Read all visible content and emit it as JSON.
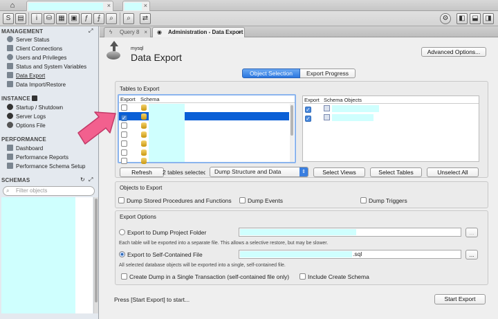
{
  "connection_tabs": [
    {
      "label": "",
      "close": "×"
    },
    {
      "label": "",
      "close": "×"
    }
  ],
  "sidebar": {
    "management_title": "MANAGEMENT",
    "management_items": [
      {
        "label": "Server Status",
        "icon": "server-status-icon"
      },
      {
        "label": "Client Connections",
        "icon": "client-connections-icon"
      },
      {
        "label": "Users and Privileges",
        "icon": "users-icon"
      },
      {
        "label": "Status and System Variables",
        "icon": "variables-icon"
      },
      {
        "label": "Data Export",
        "icon": "data-export-icon"
      },
      {
        "label": "Data Import/Restore",
        "icon": "data-import-icon"
      }
    ],
    "instance_title": "INSTANCE",
    "instance_items": [
      {
        "label": "Startup / Shutdown"
      },
      {
        "label": "Server Logs"
      },
      {
        "label": "Options File"
      }
    ],
    "performance_title": "PERFORMANCE",
    "performance_items": [
      {
        "label": "Dashboard"
      },
      {
        "label": "Performance Reports"
      },
      {
        "label": "Performance Schema Setup"
      }
    ],
    "schemas_title": "SCHEMAS",
    "filter_placeholder": "Filter objects"
  },
  "doc_tabs": [
    {
      "label": "Query 8",
      "close": "×"
    },
    {
      "label": "Administration - Data Export",
      "close": "×"
    }
  ],
  "header": {
    "subtitle": "mysql",
    "title": "Data Export",
    "advanced_button": "Advanced Options..."
  },
  "view_tabs": {
    "selected": "Object Selection",
    "other": "Export Progress"
  },
  "tables_to_export": {
    "title": "Tables to Export",
    "col_export": "Export",
    "col_schema": "Schema",
    "col_export2": "Export",
    "col_schema_objects": "Schema Objects",
    "refresh_button": "Refresh",
    "selected_count": "2 tables selected",
    "dump_mode": "Dump Structure and Data",
    "select_views_button": "Select Views",
    "select_tables_button": "Select Tables",
    "unselect_all_button": "Unselect All"
  },
  "objects_to_export": {
    "title": "Objects to Export",
    "dump_routines": "Dump Stored Procedures and Functions",
    "dump_events": "Dump Events",
    "dump_triggers": "Dump Triggers"
  },
  "export_options": {
    "title": "Export Options",
    "to_folder": "Export to Dump Project Folder",
    "folder_note": "Each table will be exported into a separate file. This allows a selective restore, but may be slower.",
    "to_file": "Export to Self-Contained File",
    "file_suffix": ".sql",
    "file_note": "All selected database objects will be exported into a single, self-contained file.",
    "single_transaction": "Create Dump in a Single Transaction (self-contained file only)",
    "include_schema": "Include Create Schema",
    "browse": "..."
  },
  "footer": {
    "hint": "Press [Start Export] to start...",
    "start_button": "Start Export"
  },
  "colors": {
    "accent": "#4a89dc",
    "highlight": "#0a5fd6",
    "arrow": "#f2608e",
    "redacted": "#cffffe"
  }
}
